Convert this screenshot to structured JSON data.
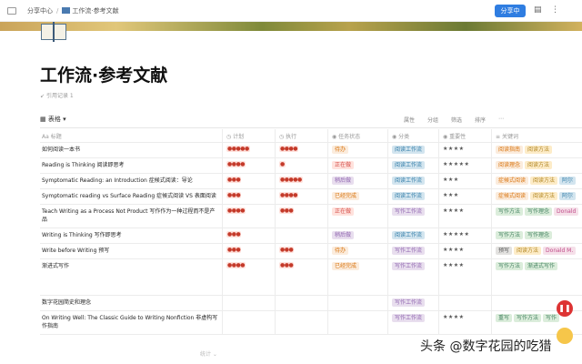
{
  "topbar": {
    "breadcrumb_space": "分享中心",
    "breadcrumb_sep": "/",
    "breadcrumb_page": "工作流·参考文献",
    "share_label": "分享中"
  },
  "page": {
    "title": "工作流·参考文献",
    "backlinks": "引用记录 1"
  },
  "viewbar": {
    "view_name": "表格 ▾",
    "tools": [
      "属性",
      "分组",
      "筛选",
      "排序",
      "⋯"
    ]
  },
  "table": {
    "columns": [
      "标题",
      "计划",
      "执行",
      "任务状态",
      "分类",
      "重要性",
      "关键词"
    ],
    "rows": [
      {
        "title": "如何阅读一本书",
        "plan": "●●●●●",
        "exec": "●●●●",
        "status": "待办",
        "category": "阅读工作流",
        "importance": "★★★★",
        "keywords": [
          "阅读指南",
          "阅读方法"
        ]
      },
      {
        "title": "Reading is Thinking 阅读即思考",
        "plan": "●●●●",
        "exec": "●",
        "status": "正在做",
        "category": "阅读工作流",
        "importance": "★★★★★",
        "keywords": [
          "阅读理念",
          "阅读方法"
        ]
      },
      {
        "title": "Symptomatic Reading: an Introduction  症候式阅读：导论",
        "plan": "●●●",
        "exec": "●●●●●",
        "status": "稍后做",
        "category": "阅读工作流",
        "importance": "★★★",
        "keywords": [
          "症候式阅读",
          "阅读方法",
          "阿尔"
        ]
      },
      {
        "title": "Symptomatic reading vs Surface Reading 症候式阅读 VS 表面阅读",
        "plan": "●●●",
        "exec": "●●●●",
        "status": "已经完成",
        "category": "阅读工作流",
        "importance": "★★★",
        "keywords": [
          "症候式阅读",
          "阅读方法",
          "阿尔"
        ]
      },
      {
        "title": "Teach Writing as a Process Not Product  写作作为一种过程而不是产品",
        "plan": "●●●●",
        "exec": "●●●",
        "status": "正在做",
        "category": "写作工作流",
        "importance": "★★★★",
        "keywords": [
          "写作方法",
          "写作理念",
          "Donald"
        ]
      },
      {
        "title": "Writing is Thinking 写作即思考",
        "plan": "●●●",
        "exec": "",
        "status": "稍后做",
        "category": "阅读工作流",
        "importance": "★★★★★",
        "keywords": [
          "写作方法",
          "写作理念"
        ]
      },
      {
        "title": "Write before Writing  预写",
        "plan": "●●●",
        "exec": "●●●",
        "status": "待办",
        "category": "写作工作流",
        "importance": "★★★★",
        "keywords": [
          "预写",
          "阅读方法",
          "Donald M."
        ]
      },
      {
        "title": "渐进式写作",
        "plan": "●●●●",
        "exec": "●●●",
        "status": "已经完成",
        "category": "写作工作流",
        "importance": "★★★★",
        "keywords": [
          "写作方法",
          "渐进式写作"
        ]
      },
      {
        "title": "数字花园简史和理念",
        "plan": "",
        "exec": "",
        "status": "",
        "category": "写作工作流",
        "importance": "",
        "keywords": []
      },
      {
        "title": "On Writing Well: The Classic Guide to Writing Nonfiction 非虚构写作指南",
        "plan": "",
        "exec": "",
        "status": "",
        "category": "写作工作流",
        "importance": "★★★★",
        "keywords": [
          "重写",
          "写作方法",
          "写作"
        ]
      }
    ],
    "footer": "统计 ⌄"
  },
  "watermark": "头条 @数字花园的吃猎",
  "colors": {
    "accent": "#2f7de1"
  }
}
